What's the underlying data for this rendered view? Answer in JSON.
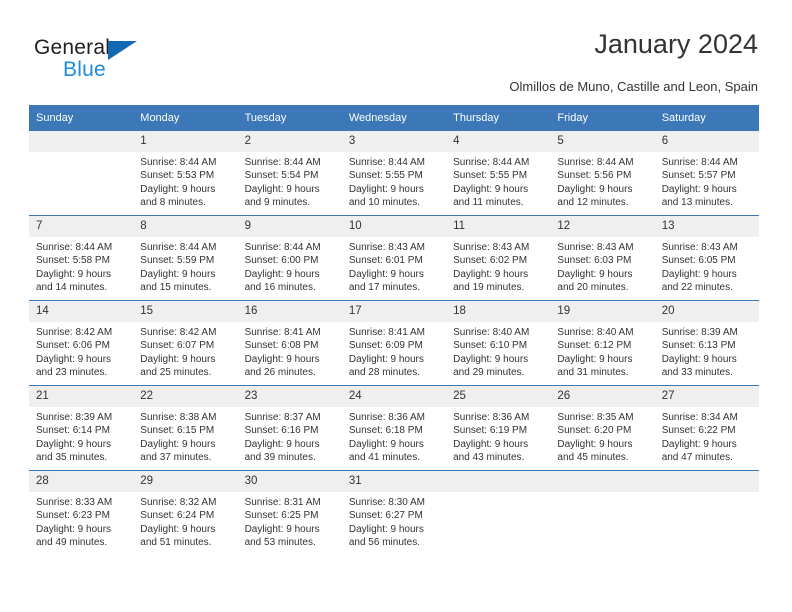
{
  "brand": {
    "name_part1": "General",
    "name_part2": "Blue",
    "triangle_color": "#1268b3",
    "blue_color": "#1e8ae0"
  },
  "header": {
    "title": "January 2024",
    "subtitle": "Olmillos de Muno, Castille and Leon, Spain"
  },
  "theme": {
    "header_bg": "#3c78b8",
    "daynum_bg": "#efefef",
    "text": "#333333"
  },
  "calendar": {
    "weekday_headers": [
      "Sunday",
      "Monday",
      "Tuesday",
      "Wednesday",
      "Thursday",
      "Friday",
      "Saturday"
    ],
    "weeks": [
      [
        {
          "day": "",
          "lines": []
        },
        {
          "day": "1",
          "lines": [
            "Sunrise: 8:44 AM",
            "Sunset: 5:53 PM",
            "Daylight: 9 hours",
            "and 8 minutes."
          ]
        },
        {
          "day": "2",
          "lines": [
            "Sunrise: 8:44 AM",
            "Sunset: 5:54 PM",
            "Daylight: 9 hours",
            "and 9 minutes."
          ]
        },
        {
          "day": "3",
          "lines": [
            "Sunrise: 8:44 AM",
            "Sunset: 5:55 PM",
            "Daylight: 9 hours",
            "and 10 minutes."
          ]
        },
        {
          "day": "4",
          "lines": [
            "Sunrise: 8:44 AM",
            "Sunset: 5:55 PM",
            "Daylight: 9 hours",
            "and 11 minutes."
          ]
        },
        {
          "day": "5",
          "lines": [
            "Sunrise: 8:44 AM",
            "Sunset: 5:56 PM",
            "Daylight: 9 hours",
            "and 12 minutes."
          ]
        },
        {
          "day": "6",
          "lines": [
            "Sunrise: 8:44 AM",
            "Sunset: 5:57 PM",
            "Daylight: 9 hours",
            "and 13 minutes."
          ]
        }
      ],
      [
        {
          "day": "7",
          "lines": [
            "Sunrise: 8:44 AM",
            "Sunset: 5:58 PM",
            "Daylight: 9 hours",
            "and 14 minutes."
          ]
        },
        {
          "day": "8",
          "lines": [
            "Sunrise: 8:44 AM",
            "Sunset: 5:59 PM",
            "Daylight: 9 hours",
            "and 15 minutes."
          ]
        },
        {
          "day": "9",
          "lines": [
            "Sunrise: 8:44 AM",
            "Sunset: 6:00 PM",
            "Daylight: 9 hours",
            "and 16 minutes."
          ]
        },
        {
          "day": "10",
          "lines": [
            "Sunrise: 8:43 AM",
            "Sunset: 6:01 PM",
            "Daylight: 9 hours",
            "and 17 minutes."
          ]
        },
        {
          "day": "11",
          "lines": [
            "Sunrise: 8:43 AM",
            "Sunset: 6:02 PM",
            "Daylight: 9 hours",
            "and 19 minutes."
          ]
        },
        {
          "day": "12",
          "lines": [
            "Sunrise: 8:43 AM",
            "Sunset: 6:03 PM",
            "Daylight: 9 hours",
            "and 20 minutes."
          ]
        },
        {
          "day": "13",
          "lines": [
            "Sunrise: 8:43 AM",
            "Sunset: 6:05 PM",
            "Daylight: 9 hours",
            "and 22 minutes."
          ]
        }
      ],
      [
        {
          "day": "14",
          "lines": [
            "Sunrise: 8:42 AM",
            "Sunset: 6:06 PM",
            "Daylight: 9 hours",
            "and 23 minutes."
          ]
        },
        {
          "day": "15",
          "lines": [
            "Sunrise: 8:42 AM",
            "Sunset: 6:07 PM",
            "Daylight: 9 hours",
            "and 25 minutes."
          ]
        },
        {
          "day": "16",
          "lines": [
            "Sunrise: 8:41 AM",
            "Sunset: 6:08 PM",
            "Daylight: 9 hours",
            "and 26 minutes."
          ]
        },
        {
          "day": "17",
          "lines": [
            "Sunrise: 8:41 AM",
            "Sunset: 6:09 PM",
            "Daylight: 9 hours",
            "and 28 minutes."
          ]
        },
        {
          "day": "18",
          "lines": [
            "Sunrise: 8:40 AM",
            "Sunset: 6:10 PM",
            "Daylight: 9 hours",
            "and 29 minutes."
          ]
        },
        {
          "day": "19",
          "lines": [
            "Sunrise: 8:40 AM",
            "Sunset: 6:12 PM",
            "Daylight: 9 hours",
            "and 31 minutes."
          ]
        },
        {
          "day": "20",
          "lines": [
            "Sunrise: 8:39 AM",
            "Sunset: 6:13 PM",
            "Daylight: 9 hours",
            "and 33 minutes."
          ]
        }
      ],
      [
        {
          "day": "21",
          "lines": [
            "Sunrise: 8:39 AM",
            "Sunset: 6:14 PM",
            "Daylight: 9 hours",
            "and 35 minutes."
          ]
        },
        {
          "day": "22",
          "lines": [
            "Sunrise: 8:38 AM",
            "Sunset: 6:15 PM",
            "Daylight: 9 hours",
            "and 37 minutes."
          ]
        },
        {
          "day": "23",
          "lines": [
            "Sunrise: 8:37 AM",
            "Sunset: 6:16 PM",
            "Daylight: 9 hours",
            "and 39 minutes."
          ]
        },
        {
          "day": "24",
          "lines": [
            "Sunrise: 8:36 AM",
            "Sunset: 6:18 PM",
            "Daylight: 9 hours",
            "and 41 minutes."
          ]
        },
        {
          "day": "25",
          "lines": [
            "Sunrise: 8:36 AM",
            "Sunset: 6:19 PM",
            "Daylight: 9 hours",
            "and 43 minutes."
          ]
        },
        {
          "day": "26",
          "lines": [
            "Sunrise: 8:35 AM",
            "Sunset: 6:20 PM",
            "Daylight: 9 hours",
            "and 45 minutes."
          ]
        },
        {
          "day": "27",
          "lines": [
            "Sunrise: 8:34 AM",
            "Sunset: 6:22 PM",
            "Daylight: 9 hours",
            "and 47 minutes."
          ]
        }
      ],
      [
        {
          "day": "28",
          "lines": [
            "Sunrise: 8:33 AM",
            "Sunset: 6:23 PM",
            "Daylight: 9 hours",
            "and 49 minutes."
          ]
        },
        {
          "day": "29",
          "lines": [
            "Sunrise: 8:32 AM",
            "Sunset: 6:24 PM",
            "Daylight: 9 hours",
            "and 51 minutes."
          ]
        },
        {
          "day": "30",
          "lines": [
            "Sunrise: 8:31 AM",
            "Sunset: 6:25 PM",
            "Daylight: 9 hours",
            "and 53 minutes."
          ]
        },
        {
          "day": "31",
          "lines": [
            "Sunrise: 8:30 AM",
            "Sunset: 6:27 PM",
            "Daylight: 9 hours",
            "and 56 minutes."
          ]
        },
        {
          "day": "",
          "lines": []
        },
        {
          "day": "",
          "lines": []
        },
        {
          "day": "",
          "lines": []
        }
      ]
    ]
  }
}
